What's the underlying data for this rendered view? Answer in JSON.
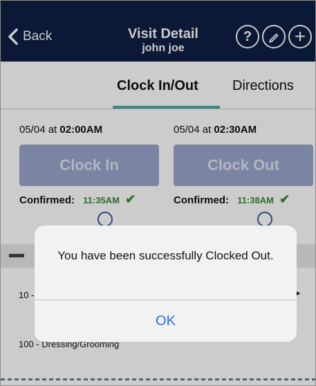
{
  "header": {
    "back_label": "Back",
    "title": "Visit Detail",
    "subtitle": "john joe",
    "icons": [
      "help-icon",
      "edit-icon",
      "add-icon"
    ],
    "help_glyph": "?",
    "add_glyph": "+"
  },
  "tabs": [
    {
      "label": "Clock In/Out",
      "active": true
    },
    {
      "label": "Directions",
      "active": false
    }
  ],
  "clock_in": {
    "date": "05/04 at",
    "time": "02:00AM",
    "button_label": "Clock In",
    "confirmed_label": "Confirmed:",
    "confirmed_time": "11:35AM",
    "check": "✔"
  },
  "clock_out": {
    "date": "05/04 at",
    "time": "02:30AM",
    "button_label": "Clock Out",
    "confirmed_label": "Confirmed:",
    "confirmed_time": "11:38AM",
    "check": "✔"
  },
  "list": {
    "row1": "10 -",
    "row2": "100 - Dressing/Grooming"
  },
  "alert": {
    "message": "You have been successfully Clocked Out.",
    "ok_label": "OK"
  },
  "colors": {
    "header_bg": "#0e1f44",
    "tab_underline": "#4aa8a2",
    "button_disabled": "#9aa5cc",
    "confirm_green": "#3a8a3a",
    "alert_link": "#2f6de1"
  }
}
